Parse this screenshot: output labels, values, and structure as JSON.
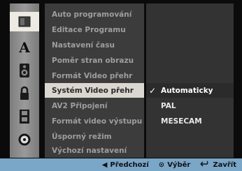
{
  "menu": {
    "items": [
      {
        "label": "Auto programování"
      },
      {
        "label": "Editace Programu"
      },
      {
        "label": "Nastavení času"
      },
      {
        "label": "Poměr stran obrazu"
      },
      {
        "label": "Formát Video přehr"
      },
      {
        "label": "Systém Video přehr",
        "selected": true
      },
      {
        "label": "AV2 Připojení"
      },
      {
        "label": "Formát video výstupu"
      },
      {
        "label": "Úsporný režim"
      },
      {
        "label": "Výchozí nastavení"
      }
    ]
  },
  "submenu": {
    "items": [
      {
        "label": "Automaticky",
        "checked": true
      },
      {
        "label": "PAL"
      },
      {
        "label": "MESECAM"
      }
    ],
    "check_glyph": "✓"
  },
  "icons": [
    {
      "name": "setup-panel-icon"
    },
    {
      "name": "language-a-icon"
    },
    {
      "name": "audio-speaker-icon"
    },
    {
      "name": "lock-icon"
    },
    {
      "name": "film-record-icon"
    },
    {
      "name": "disc-icon"
    }
  ],
  "footer": {
    "prev_glyph": "◀",
    "prev_label": "Předchozí",
    "select_glyph": "⊙",
    "select_label": "Výběr",
    "close_glyph": "ꗃ",
    "close_label": "Zavřít"
  },
  "colors": {
    "accent": "#7aa6c8",
    "selected_bg": "#d9d7cf"
  }
}
